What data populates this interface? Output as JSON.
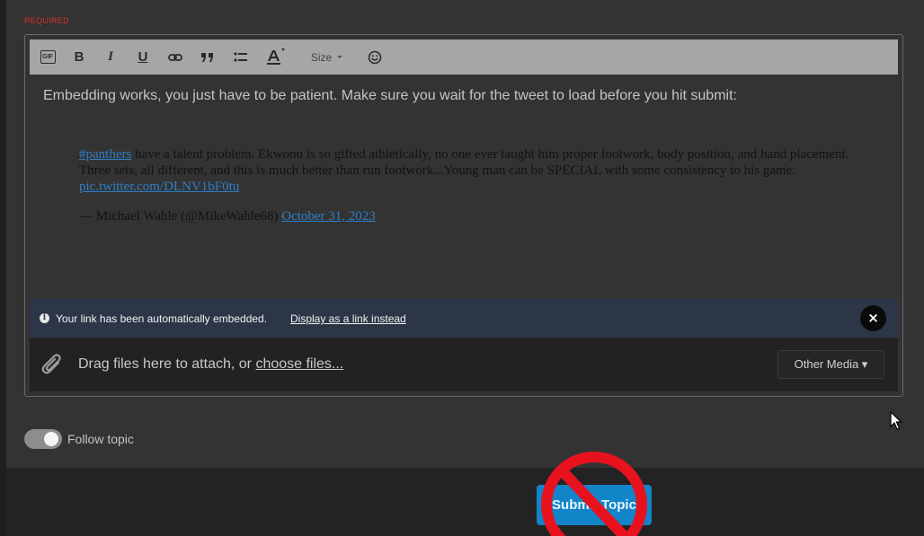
{
  "form": {
    "required_label": "REQUIRED"
  },
  "toolbar": {
    "gif": "GIF",
    "bold": "B",
    "italic": "I",
    "underline": "U",
    "size": "Size"
  },
  "editor": {
    "body_text": "Embedding works, you just have to be patient. Make sure you wait for the tweet to load before you hit submit:",
    "tweet": {
      "hashtag": "#panthers",
      "text": " have a talent problem. Ekwonu is so gifted athletically, no one ever taught him proper footwork, body position, and hand placement. Three sets, all different, and this is much better than run footwork...Young man can be SPECIAL with some consistency to his game. ",
      "pic_link": "pic.twitter.com/DLNV1bF0tu",
      "attribution": "— Michael Wahle (@MikeWahle68) ",
      "date_link": "October 31, 2023"
    }
  },
  "embed_notice": {
    "message": "Your link has been automatically embedded.",
    "link_label": "Display as a link instead",
    "close": "×"
  },
  "attach": {
    "prefix": "Drag files here to attach, or ",
    "choose_label": "choose files...",
    "other_media": "Other Media ▾"
  },
  "follow": {
    "label": "Follow topic",
    "enabled": true
  },
  "submit": {
    "label": "Submit Topic"
  },
  "colors": {
    "accent": "#1285c8",
    "required": "#d9312b",
    "embed_bar": "#2d3647"
  }
}
